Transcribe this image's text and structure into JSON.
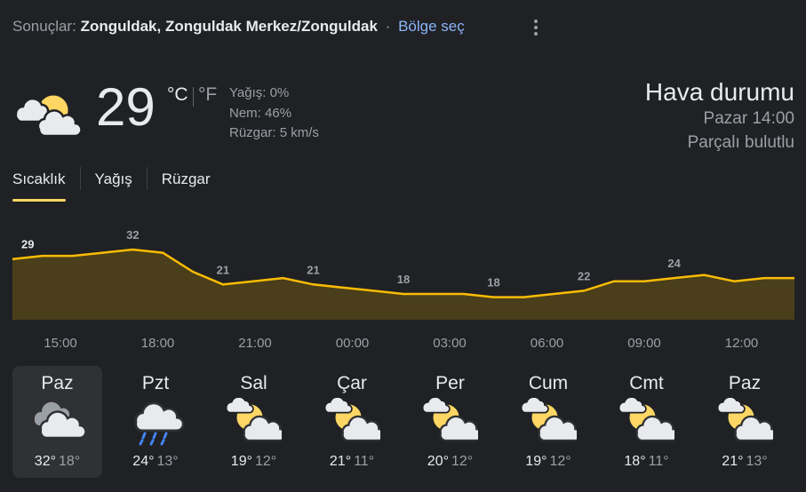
{
  "header": {
    "results_label": "Sonuçlar:",
    "location": "Zonguldak, Zonguldak Merkez/Zonguldak",
    "separator": "·",
    "region_link": "Bölge seç",
    "menu_icon": "more-vert-icon"
  },
  "current": {
    "icon": "partly-cloudy-icon",
    "temperature": "29",
    "unit_c": "°C",
    "unit_f": "°F",
    "precipitation": "Yağış: 0%",
    "humidity": "Nem: 46%",
    "wind": "Rüzgar: 5 km/s"
  },
  "summary": {
    "title": "Hava durumu",
    "datetime": "Pazar 14:00",
    "condition": "Parçalı bulutlu"
  },
  "tabs": [
    {
      "label": "Sıcaklık",
      "active": true
    },
    {
      "label": "Yağış",
      "active": false
    },
    {
      "label": "Rüzgar",
      "active": false
    }
  ],
  "chart_data": {
    "type": "area",
    "x": [
      "14:00",
      "15:00",
      "16:00",
      "17:00",
      "18:00",
      "19:00",
      "20:00",
      "21:00",
      "22:00",
      "23:00",
      "00:00",
      "01:00",
      "02:00",
      "03:00",
      "04:00",
      "05:00",
      "06:00",
      "07:00",
      "08:00",
      "09:00",
      "10:00",
      "11:00",
      "12:00",
      "13:00"
    ],
    "values": [
      29,
      30,
      30,
      31,
      32,
      31,
      25,
      21,
      21,
      22,
      21,
      20,
      19,
      18,
      18,
      18,
      18,
      18,
      18,
      19,
      22,
      22,
      23,
      24,
      24,
      22,
      23,
      23
    ],
    "hours": [
      29,
      30,
      30,
      31,
      32,
      31,
      25,
      21,
      22,
      23,
      21,
      20,
      19,
      18,
      18,
      18,
      17,
      17,
      18,
      19,
      22,
      22,
      23,
      24,
      22,
      23,
      23
    ],
    "label_values": [
      "29",
      "32",
      "21",
      "21",
      "18",
      "18",
      "22",
      "24"
    ],
    "time_labels": [
      "15:00",
      "18:00",
      "21:00",
      "00:00",
      "03:00",
      "06:00",
      "09:00",
      "12:00"
    ],
    "colors": {
      "line": "#fbbc04",
      "fill": "#4a3f1a"
    }
  },
  "days": [
    {
      "name": "Paz",
      "icon": "cloudy-icon",
      "hi": "32°",
      "lo": "18°",
      "selected": true
    },
    {
      "name": "Pzt",
      "icon": "rain-icon",
      "hi": "24°",
      "lo": "13°",
      "selected": false
    },
    {
      "name": "Sal",
      "icon": "partly-cloudy-icon",
      "hi": "19°",
      "lo": "12°",
      "selected": false
    },
    {
      "name": "Çar",
      "icon": "partly-cloudy-icon",
      "hi": "21°",
      "lo": "11°",
      "selected": false
    },
    {
      "name": "Per",
      "icon": "partly-cloudy-icon",
      "hi": "20°",
      "lo": "12°",
      "selected": false
    },
    {
      "name": "Cum",
      "icon": "partly-cloudy-icon",
      "hi": "19°",
      "lo": "12°",
      "selected": false
    },
    {
      "name": "Cmt",
      "icon": "partly-cloudy-icon",
      "hi": "18°",
      "lo": "11°",
      "selected": false
    },
    {
      "name": "Paz",
      "icon": "partly-cloudy-icon",
      "hi": "21°",
      "lo": "13°",
      "selected": false
    }
  ]
}
